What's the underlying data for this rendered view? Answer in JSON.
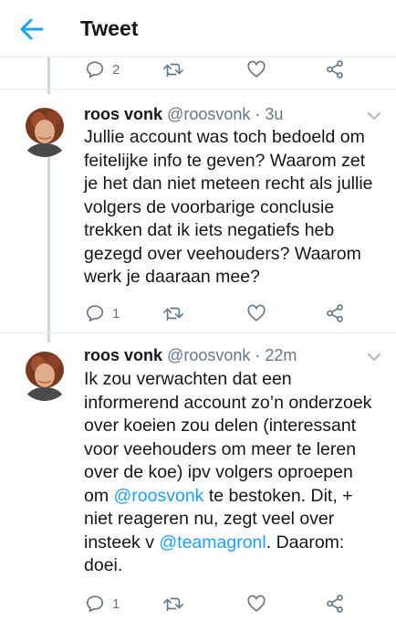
{
  "header": {
    "title": "Tweet"
  },
  "top_actions": {
    "reply_count": "2",
    "retweet_count": "",
    "like_count": ""
  },
  "tweets": [
    {
      "name": "roos vonk",
      "handle": "@roosvonk",
      "separator": "·",
      "time": "3u",
      "lines": [
        "Jullie account was toch bedoeld om",
        "feitelijke info te geven? Waarom zet",
        "je het dan niet meteen recht als jullie",
        "volgers de voorbarige conclusie",
        "trekken dat ik iets negatiefs heb",
        "gezegd over veehouders? Waarom",
        "werk je daaraan mee?"
      ],
      "reply_count": "1"
    },
    {
      "name": "roos vonk",
      "handle": "@roosvonk",
      "separator": "·",
      "time": "22m",
      "line1": "Ik zou verwachten dat een",
      "line2": "informerend account zo’n onderzoek",
      "line3": "over koeien zou delen (interessant",
      "line4": "voor veehouders om meer te leren",
      "line5": "over de koe) ipv volgers oproepen",
      "line6_pre": "om ",
      "line6_mention": "@roosvonk",
      "line6_post": " te bestoken. Dit, +",
      "line7": "niet reageren nu, zegt veel over",
      "line8_pre": "insteek v ",
      "line8_mention": "@teamagronl",
      "line8_post": ".  Daarom:",
      "line9": "doei.",
      "reply_count": "1"
    }
  ],
  "colors": {
    "accent": "#1da1f2",
    "secondary": "#657786",
    "divider": "#e6ecf0",
    "thread": "#ccd6dd"
  },
  "icons": [
    "back-arrow-icon",
    "reply-icon",
    "retweet-icon",
    "like-icon",
    "share-icon",
    "chevron-down-icon"
  ]
}
